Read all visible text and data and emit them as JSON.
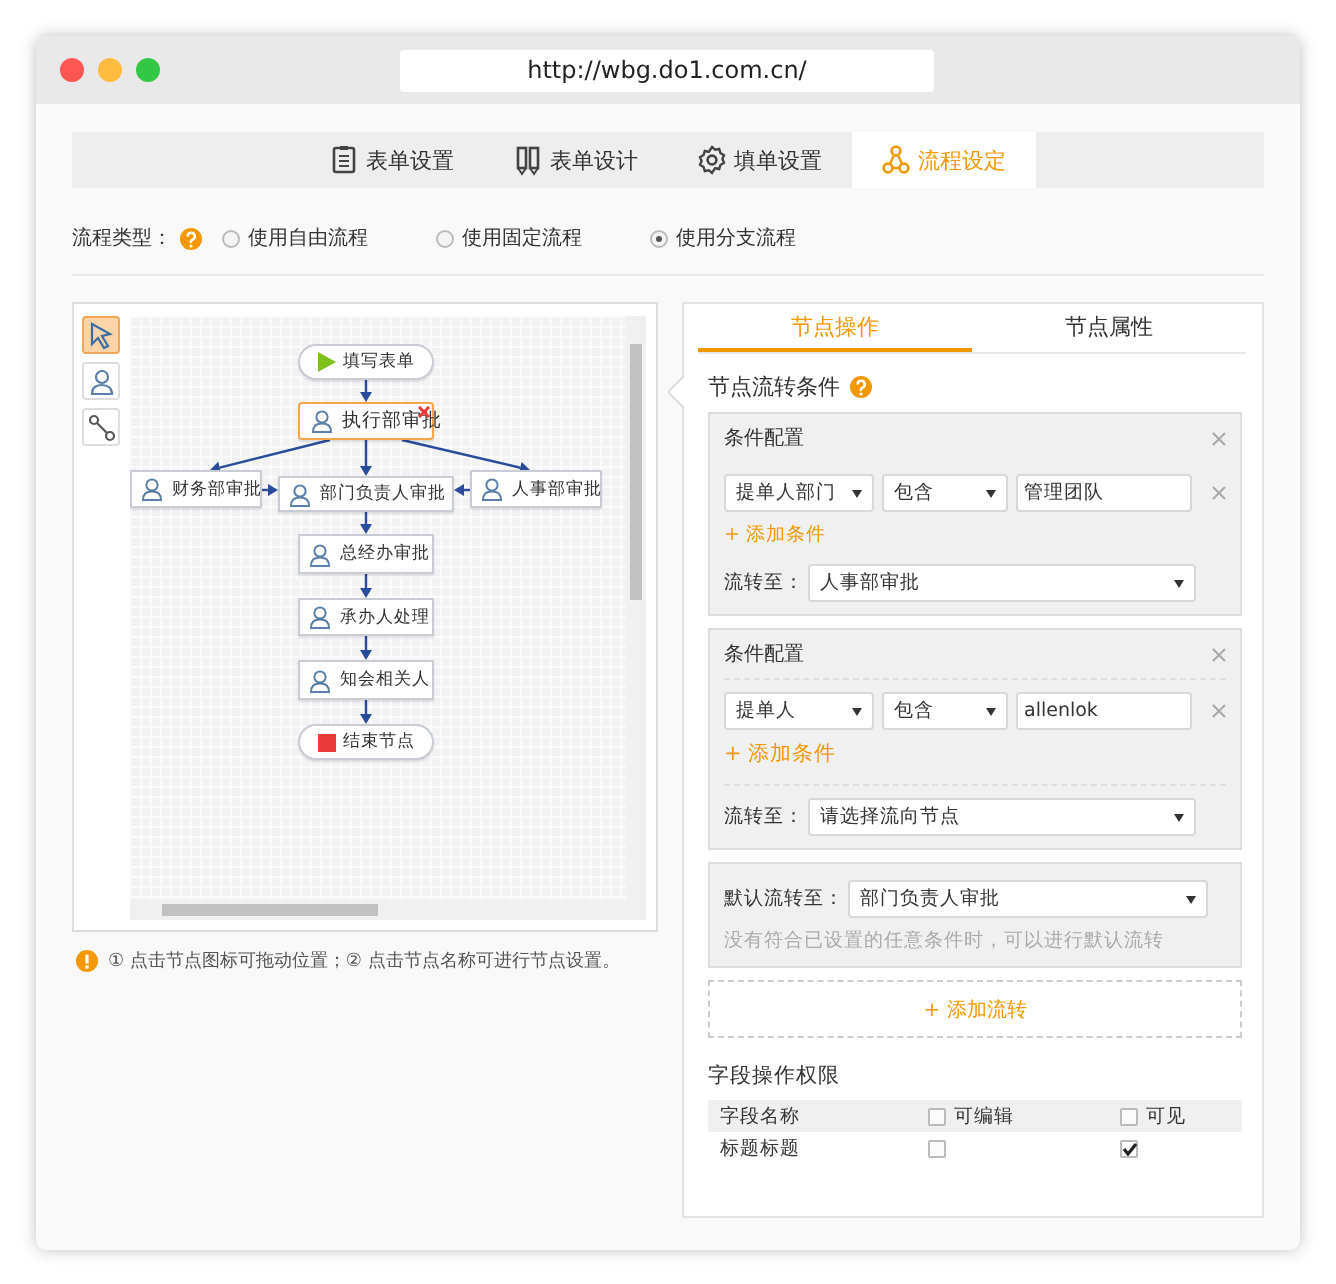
{
  "browser": {
    "url": "http://wbg.do1.com.cn/"
  },
  "tabs": [
    {
      "label": "表单设置",
      "selected": false
    },
    {
      "label": "表单设计",
      "selected": false
    },
    {
      "label": "填单设置",
      "selected": false
    },
    {
      "label": "流程设定",
      "selected": true
    }
  ],
  "flow_type": {
    "label": "流程类型：",
    "options": [
      {
        "label": "使用自由流程",
        "selected": false
      },
      {
        "label": "使用固定流程",
        "selected": false
      },
      {
        "label": "使用分支流程",
        "selected": true
      }
    ]
  },
  "tools": [
    {
      "selected": true
    },
    {
      "selected": false
    },
    {
      "selected": false
    }
  ],
  "flow_nodes": [
    {
      "kind": "start",
      "label": "填写表单",
      "selected": false
    },
    {
      "kind": "task",
      "label": "执行部审批",
      "selected": true
    },
    {
      "kind": "task",
      "label": "财务部审批",
      "selected": false
    },
    {
      "kind": "task",
      "label": "部门负责人审批",
      "selected": false
    },
    {
      "kind": "task",
      "label": "人事部审批",
      "selected": false
    },
    {
      "kind": "task",
      "label": "总经办审批",
      "selected": false
    },
    {
      "kind": "task",
      "label": "承办人处理",
      "selected": false
    },
    {
      "kind": "task",
      "label": "知会相关人",
      "selected": false
    },
    {
      "kind": "end",
      "label": "结束节点",
      "selected": false
    }
  ],
  "hint": "① 点击节点图标可拖动位置；② 点击节点名称可进行节点设置。",
  "panel_tabs": [
    {
      "label": "节点操作",
      "selected": true
    },
    {
      "label": "节点属性",
      "selected": false
    }
  ],
  "section_title": "节点流转条件",
  "condition_groups": [
    {
      "title": "条件配置",
      "divided": false,
      "conditions": [
        {
          "field": "提单人部门",
          "operator": "包含",
          "value": "管理团队"
        }
      ],
      "add_label": "+ 添加条件",
      "target_label": "流转至：",
      "target": "人事部审批"
    },
    {
      "title": "条件配置",
      "divided": true,
      "conditions": [
        {
          "field": "提单人",
          "operator": "包含",
          "value": "allenlok"
        }
      ],
      "add_label": "+ 添加条件",
      "target_label": "流转至：",
      "target": "请选择流向节点"
    }
  ],
  "default_flow": {
    "label": "默认流转至：",
    "value": "部门负责人审批",
    "note": "没有符合已设置的任意条件时，可以进行默认流转"
  },
  "add_flow": "+ 添加流转",
  "permissions": {
    "title": "字段操作权限",
    "columns": [
      {
        "label": "字段名称"
      },
      {
        "label": "可编辑",
        "checked": false
      },
      {
        "label": "可见",
        "checked": false
      }
    ],
    "rows": [
      {
        "name": "标题标题",
        "editable": false,
        "visible": true
      }
    ]
  }
}
